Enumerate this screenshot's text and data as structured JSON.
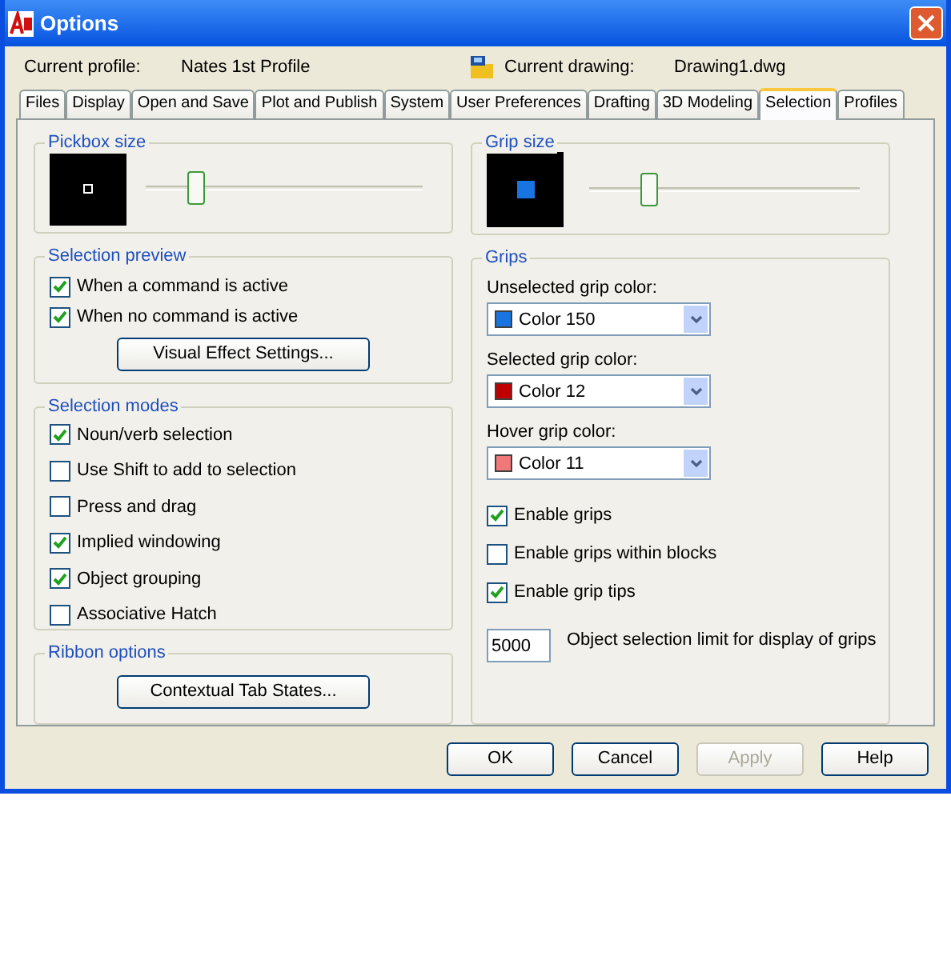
{
  "window": {
    "title": "Options"
  },
  "profile": {
    "label": "Current profile:",
    "value": "Nates 1st Profile"
  },
  "drawing": {
    "label": "Current drawing:",
    "value": "Drawing1.dwg"
  },
  "tabs": [
    {
      "label": "Files",
      "selected": false
    },
    {
      "label": "Display",
      "selected": false
    },
    {
      "label": "Open and Save",
      "selected": false
    },
    {
      "label": "Plot and Publish",
      "selected": false
    },
    {
      "label": "System",
      "selected": false
    },
    {
      "label": "User Preferences",
      "selected": false
    },
    {
      "label": "Drafting",
      "selected": false
    },
    {
      "label": "3D Modeling",
      "selected": false
    },
    {
      "label": "Selection",
      "selected": true
    },
    {
      "label": "Profiles",
      "selected": false
    }
  ],
  "pickbox": {
    "title": "Pickbox size",
    "level": 0.18
  },
  "selection_preview": {
    "title": "Selection preview",
    "checkboxes": [
      {
        "label": "When a command is active",
        "checked": true
      },
      {
        "label": "When no command is active",
        "checked": true
      }
    ],
    "button": "Visual Effect Settings..."
  },
  "selection_modes": {
    "title": "Selection modes",
    "checkboxes": [
      {
        "label": "Noun/verb selection",
        "checked": true
      },
      {
        "label": "Use Shift to add to selection",
        "checked": false
      },
      {
        "label": "Press and drag",
        "checked": false
      },
      {
        "label": "Implied windowing",
        "checked": true
      },
      {
        "label": "Object grouping",
        "checked": true
      },
      {
        "label": "Associative Hatch",
        "checked": false
      }
    ]
  },
  "ribbon_options": {
    "title": "Ribbon options",
    "button": "Contextual Tab States..."
  },
  "grip_size": {
    "title": "Grip size",
    "level": 0.22
  },
  "grips": {
    "title": "Grips",
    "dropdowns": [
      {
        "label": "Unselected grip color:",
        "value": "Color 150",
        "color": "#1874e0"
      },
      {
        "label": "Selected grip color:",
        "value": "Color 12",
        "color": "#c00000"
      },
      {
        "label": "Hover grip color:",
        "value": "Color 11",
        "color": "#f07878"
      }
    ],
    "checkboxes": [
      {
        "label": "Enable grips",
        "checked": true
      },
      {
        "label": "Enable grips within blocks",
        "checked": false
      },
      {
        "label": "Enable grip tips",
        "checked": true
      }
    ],
    "limit": {
      "value": "5000",
      "label": "Object selection limit for display of grips"
    }
  },
  "buttons": [
    {
      "label": "OK",
      "disabled": false
    },
    {
      "label": "Cancel",
      "disabled": false
    },
    {
      "label": "Apply",
      "disabled": true
    },
    {
      "label": "Help",
      "disabled": false
    }
  ]
}
